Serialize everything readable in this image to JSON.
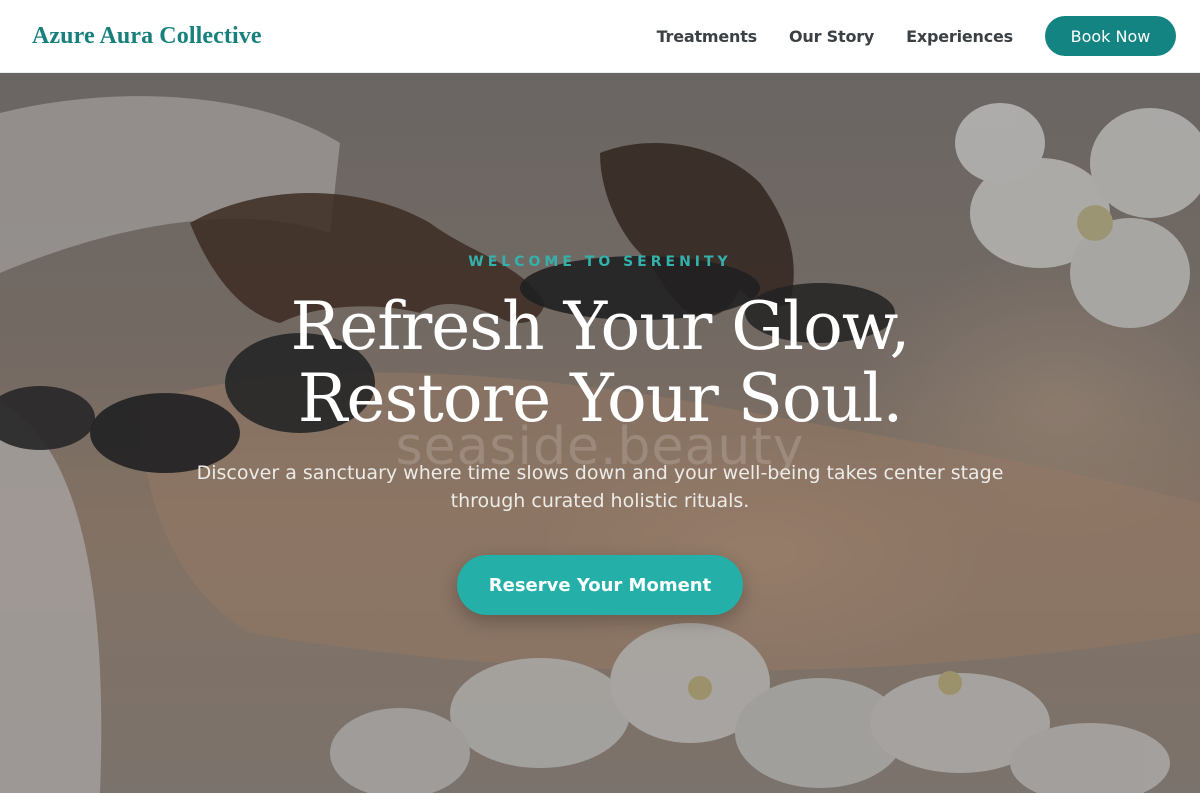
{
  "brand": {
    "name": "Azure Aura Collective",
    "accent": "#138482"
  },
  "nav": {
    "links": [
      {
        "label": "Treatments"
      },
      {
        "label": "Our Story"
      },
      {
        "label": "Experiences"
      }
    ],
    "book_label": "Book Now"
  },
  "hero": {
    "eyebrow": "WELCOME TO SERENITY",
    "headline_line1": "Refresh Your Glow,",
    "headline_line2": "Restore Your Soul.",
    "watermark": "seaside.beauty",
    "subtext_line1": "Discover a sanctuary where time slows down and your well-being takes center stage",
    "subtext_line2": "through curated holistic rituals.",
    "cta_label": "Reserve Your Moment",
    "cta_color": "#24b0a9"
  }
}
